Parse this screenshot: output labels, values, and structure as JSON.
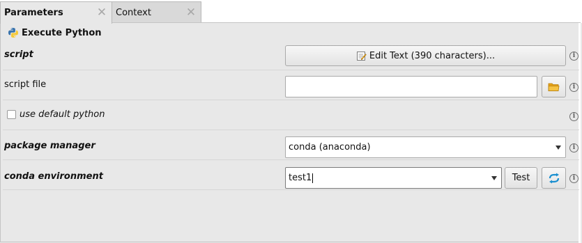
{
  "tabs": [
    {
      "label": "Parameters",
      "active": true,
      "close_icon": "close-icon"
    },
    {
      "label": "Context",
      "active": false,
      "close_icon": "close-icon"
    }
  ],
  "header": {
    "title": "Execute Python",
    "icon": "python-icon"
  },
  "rows": {
    "script": {
      "label": "script",
      "button_label": "Edit Text (390 characters)...",
      "button_icon": "edit-text-icon"
    },
    "script_file": {
      "label": "script file",
      "value": "",
      "browse_icon": "folder-icon"
    },
    "use_default_python": {
      "label": "use default python",
      "checked": false
    },
    "package_manager": {
      "label": "package manager",
      "selected": "conda (anaconda)"
    },
    "conda_environment": {
      "label": "conda environment",
      "value": "test1",
      "test_label": "Test",
      "refresh_icon": "refresh-icon"
    }
  },
  "info_icon": "info-icon",
  "colors": {
    "panel_bg": "#e8e8e8",
    "refresh_blue": "#1a8fd0",
    "folder_yellow": "#f2b01e"
  }
}
